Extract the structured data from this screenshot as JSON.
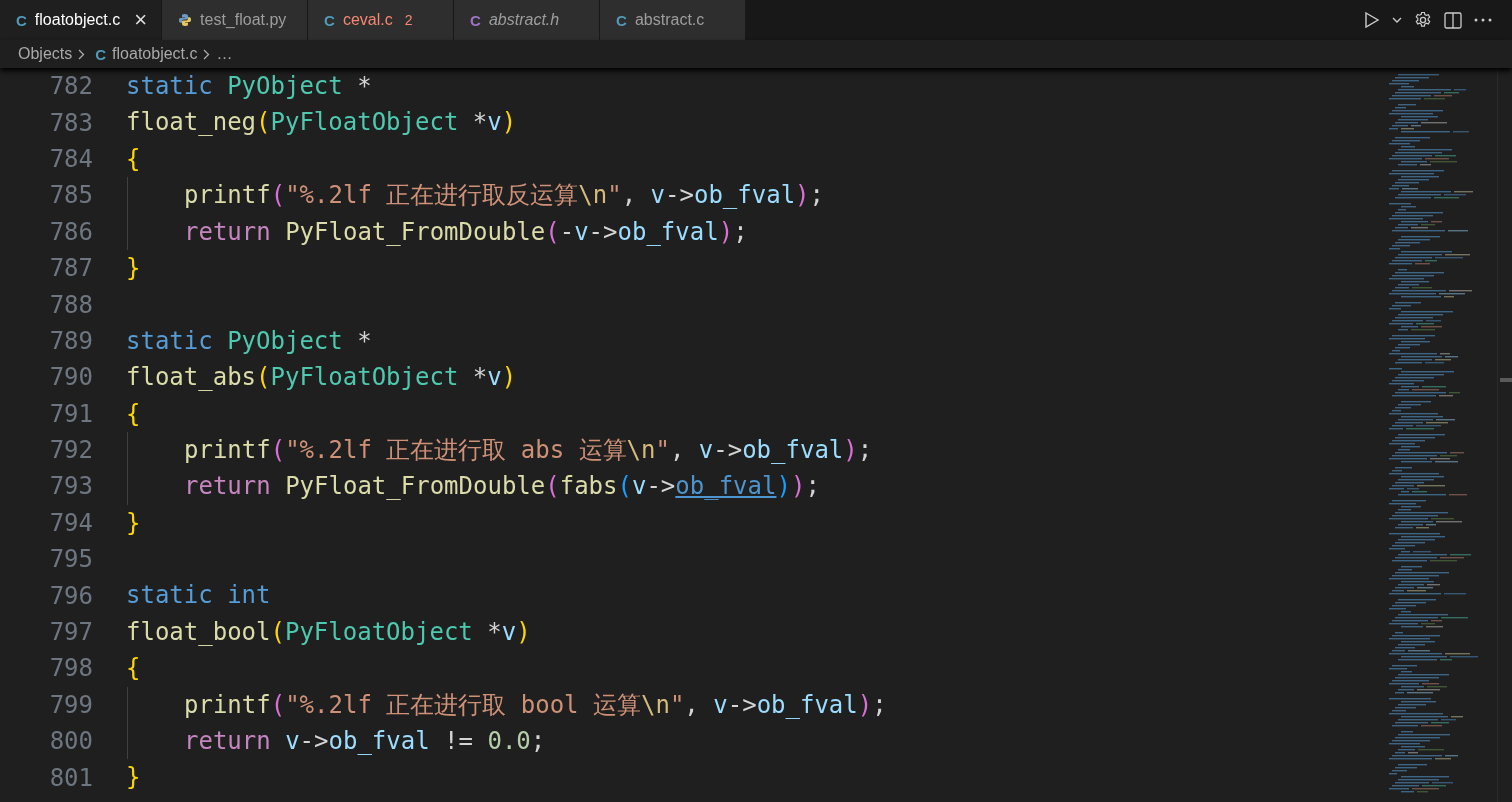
{
  "tabs": [
    {
      "kind": "letter",
      "icon_text": "C",
      "color": "#519aba",
      "label": "floatobject.c",
      "selected": true,
      "preview": false,
      "error": false,
      "close": "×"
    },
    {
      "kind": "python",
      "label": "test_float.py",
      "selected": false,
      "preview": false,
      "error": false
    },
    {
      "kind": "letter",
      "icon_text": "C",
      "color": "#519aba",
      "label": "ceval.c",
      "selected": false,
      "preview": false,
      "error": true,
      "problems": "2"
    },
    {
      "kind": "letter",
      "icon_text": "C",
      "color": "#a074c4",
      "label": "abstract.h",
      "selected": false,
      "preview": true,
      "error": false
    },
    {
      "kind": "letter",
      "icon_text": "C",
      "color": "#519aba",
      "label": "abstract.c",
      "selected": false,
      "preview": false,
      "error": false
    }
  ],
  "breadcrumbs": {
    "folder": "Objects",
    "file_icon_text": "C",
    "file": "floatobject.c",
    "more": "…"
  },
  "code_lines": [
    {
      "number": "782",
      "tokens": [
        {
          "text": "static",
          "kind": "kw"
        },
        {
          "text": " PyObject",
          "kind": "type"
        },
        {
          "text": " *",
          "kind": "plain"
        }
      ]
    },
    {
      "number": "783",
      "tokens": [
        {
          "text": "float_neg",
          "kind": "fn"
        },
        {
          "text": "(",
          "kind": "b1"
        },
        {
          "text": "PyFloatObject",
          "kind": "type"
        },
        {
          "text": " *",
          "kind": "plain"
        },
        {
          "text": "v",
          "kind": "var"
        },
        {
          "text": ")",
          "kind": "b1"
        }
      ]
    },
    {
      "number": "784",
      "tokens": [
        {
          "text": "{",
          "kind": "b1"
        }
      ],
      "children": [
        {
          "number": "785",
          "tokens": [
            {
              "text": "printf",
              "kind": "fn"
            },
            {
              "text": "(",
              "kind": "b2"
            },
            {
              "text": "\"%.2lf 正在进行取反运算",
              "kind": "str"
            },
            {
              "text": "\\n",
              "kind": "esc"
            },
            {
              "text": "\"",
              "kind": "str"
            },
            {
              "text": ", ",
              "kind": "plain"
            },
            {
              "text": "v",
              "kind": "var"
            },
            {
              "text": "->",
              "kind": "plain"
            },
            {
              "text": "ob_fval",
              "kind": "var"
            },
            {
              "text": ")",
              "kind": "b2"
            },
            {
              "text": ";",
              "kind": "plain"
            }
          ]
        },
        {
          "number": "786",
          "tokens": [
            {
              "text": "return",
              "kind": "ctrl"
            },
            {
              "text": " PyFloat_FromDouble",
              "kind": "fn"
            },
            {
              "text": "(",
              "kind": "b2"
            },
            {
              "text": "-",
              "kind": "plain"
            },
            {
              "text": "v",
              "kind": "var"
            },
            {
              "text": "->",
              "kind": "plain"
            },
            {
              "text": "ob_fval",
              "kind": "var"
            },
            {
              "text": ")",
              "kind": "b2"
            },
            {
              "text": ";",
              "kind": "plain"
            }
          ]
        }
      ]
    },
    {
      "number": "787",
      "tokens": [
        {
          "text": "}",
          "kind": "b1"
        }
      ]
    },
    {
      "number": "788"
    },
    {
      "number": "789",
      "tokens": [
        {
          "text": "static",
          "kind": "kw"
        },
        {
          "text": " PyObject",
          "kind": "type"
        },
        {
          "text": " *",
          "kind": "plain"
        }
      ]
    },
    {
      "number": "790",
      "tokens": [
        {
          "text": "float_abs",
          "kind": "fn"
        },
        {
          "text": "(",
          "kind": "b1"
        },
        {
          "text": "PyFloatObject",
          "kind": "type"
        },
        {
          "text": " *",
          "kind": "plain"
        },
        {
          "text": "v",
          "kind": "var"
        },
        {
          "text": ")",
          "kind": "b1"
        }
      ]
    },
    {
      "number": "791",
      "tokens": [
        {
          "text": "{",
          "kind": "b1"
        }
      ],
      "children": [
        {
          "number": "792",
          "tokens": [
            {
              "text": "printf",
              "kind": "fn"
            },
            {
              "text": "(",
              "kind": "b2"
            },
            {
              "text": "\"%.2lf 正在进行取 abs 运算",
              "kind": "str"
            },
            {
              "text": "\\n",
              "kind": "esc"
            },
            {
              "text": "\"",
              "kind": "str"
            },
            {
              "text": ", ",
              "kind": "plain"
            },
            {
              "text": "v",
              "kind": "var"
            },
            {
              "text": "->",
              "kind": "plain"
            },
            {
              "text": "ob_fval",
              "kind": "var"
            },
            {
              "text": ")",
              "kind": "b2"
            },
            {
              "text": ";",
              "kind": "plain"
            }
          ]
        },
        {
          "number": "793",
          "tokens": [
            {
              "text": "return",
              "kind": "ctrl"
            },
            {
              "text": " PyFloat_FromDouble",
              "kind": "fn"
            },
            {
              "text": "(",
              "kind": "b2"
            },
            {
              "text": "fabs",
              "kind": "fn"
            },
            {
              "text": "(",
              "kind": "b3"
            },
            {
              "text": "v",
              "kind": "var"
            },
            {
              "text": "->",
              "kind": "plain"
            },
            {
              "text": "ob_fval",
              "kind": "link"
            },
            {
              "text": ")",
              "kind": "b3"
            },
            {
              "text": ")",
              "kind": "b2"
            },
            {
              "text": ";",
              "kind": "plain"
            }
          ]
        }
      ]
    },
    {
      "number": "794",
      "tokens": [
        {
          "text": "}",
          "kind": "b1"
        }
      ]
    },
    {
      "number": "795"
    },
    {
      "number": "796",
      "tokens": [
        {
          "text": "static",
          "kind": "kw"
        },
        {
          "text": " int",
          "kind": "kw"
        }
      ]
    },
    {
      "number": "797",
      "tokens": [
        {
          "text": "float_bool",
          "kind": "fn"
        },
        {
          "text": "(",
          "kind": "b1"
        },
        {
          "text": "PyFloatObject",
          "kind": "type"
        },
        {
          "text": " *",
          "kind": "plain"
        },
        {
          "text": "v",
          "kind": "var"
        },
        {
          "text": ")",
          "kind": "b1"
        }
      ]
    },
    {
      "number": "798",
      "tokens": [
        {
          "text": "{",
          "kind": "b1"
        }
      ],
      "children": [
        {
          "number": "799",
          "tokens": [
            {
              "text": "printf",
              "kind": "fn"
            },
            {
              "text": "(",
              "kind": "b2"
            },
            {
              "text": "\"%.2lf 正在进行取 bool 运算",
              "kind": "str"
            },
            {
              "text": "\\n",
              "kind": "esc"
            },
            {
              "text": "\"",
              "kind": "str"
            },
            {
              "text": ", ",
              "kind": "plain"
            },
            {
              "text": "v",
              "kind": "var"
            },
            {
              "text": "->",
              "kind": "plain"
            },
            {
              "text": "ob_fval",
              "kind": "var"
            },
            {
              "text": ")",
              "kind": "b2"
            },
            {
              "text": ";",
              "kind": "plain"
            }
          ]
        },
        {
          "number": "800",
          "tokens": [
            {
              "text": "return",
              "kind": "ctrl"
            },
            {
              "text": " v",
              "kind": "var"
            },
            {
              "text": "->",
              "kind": "plain"
            },
            {
              "text": "ob_fval",
              "kind": "var"
            },
            {
              "text": " != ",
              "kind": "plain"
            },
            {
              "text": "0.0",
              "kind": "num"
            },
            {
              "text": ";",
              "kind": "plain"
            }
          ]
        }
      ]
    },
    {
      "number": "801",
      "tokens": [
        {
          "text": "}",
          "kind": "b1"
        }
      ]
    }
  ]
}
